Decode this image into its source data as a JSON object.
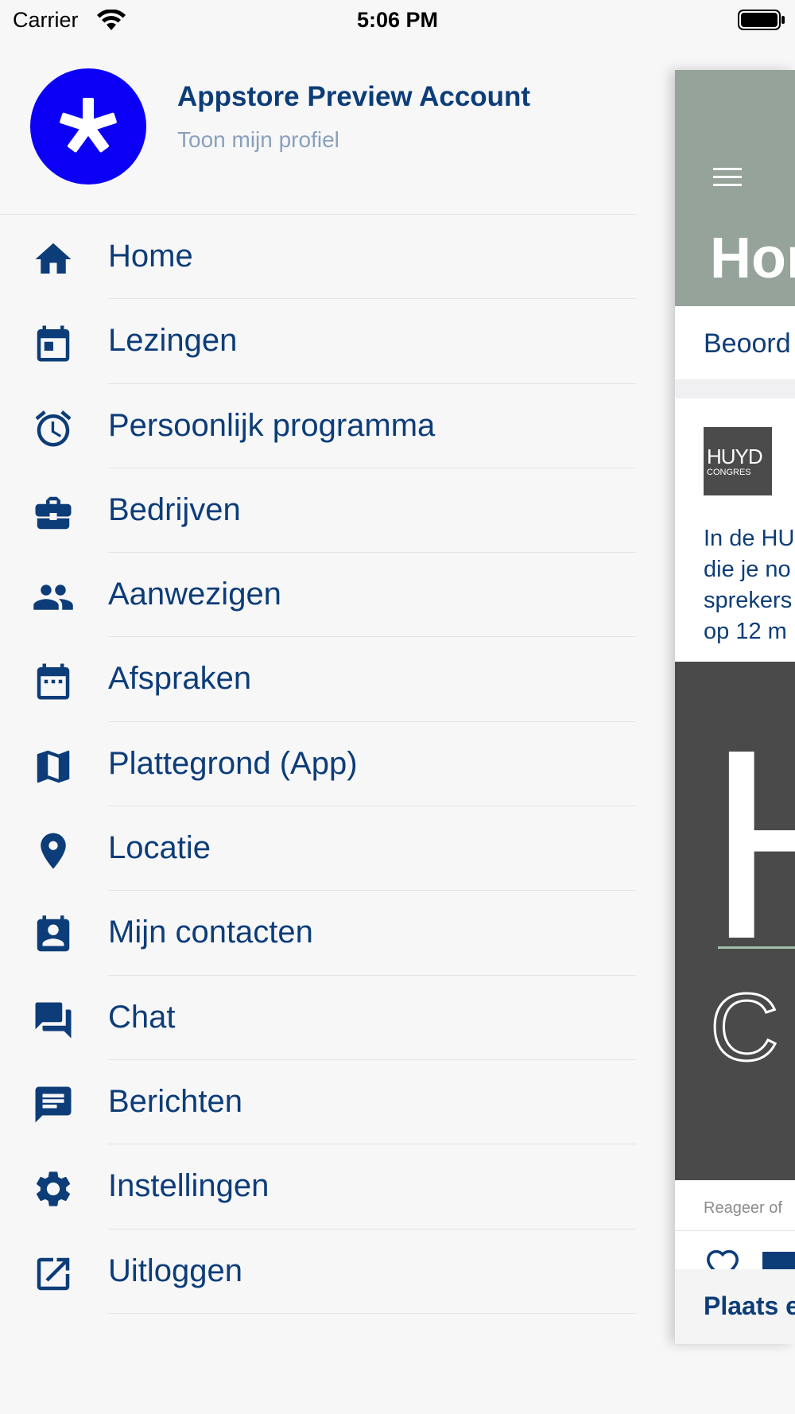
{
  "status_bar": {
    "carrier": "Carrier",
    "time": "5:06 PM"
  },
  "profile": {
    "name": "Appstore Preview Account",
    "subtitle": "Toon mijn profiel"
  },
  "menu": [
    {
      "label": "Home",
      "icon": "home-icon"
    },
    {
      "label": "Lezingen",
      "icon": "calendar-today-icon"
    },
    {
      "label": "Persoonlijk programma",
      "icon": "alarm-icon"
    },
    {
      "label": "Bedrijven",
      "icon": "briefcase-icon"
    },
    {
      "label": "Aanwezigen",
      "icon": "people-icon"
    },
    {
      "label": "Afspraken",
      "icon": "calendar-dots-icon"
    },
    {
      "label": "Plattegrond (App)",
      "icon": "map-icon"
    },
    {
      "label": "Locatie",
      "icon": "location-pin-icon"
    },
    {
      "label": "Mijn contacten",
      "icon": "contacts-icon"
    },
    {
      "label": "Chat",
      "icon": "chat-bubbles-icon"
    },
    {
      "label": "Berichten",
      "icon": "message-icon"
    },
    {
      "label": "Instellingen",
      "icon": "gear-icon"
    },
    {
      "label": "Uitloggen",
      "icon": "external-link-icon"
    }
  ],
  "peek": {
    "title": "Hor",
    "tab_label": "Beoord",
    "logo_line1": "HUYD",
    "logo_line2": "CONGRES",
    "text_lines": [
      "In de HU",
      "die je no",
      "sprekers",
      "op 12 m"
    ],
    "image_letter_1": "H",
    "image_letter_2": "C",
    "react_label": "Reageer of",
    "bottom_label": "Plaats e"
  },
  "colors": {
    "accent": "#0d3d78",
    "avatar": "#0b00f5",
    "header": "#95a39a",
    "background": "#f7f7f8"
  }
}
